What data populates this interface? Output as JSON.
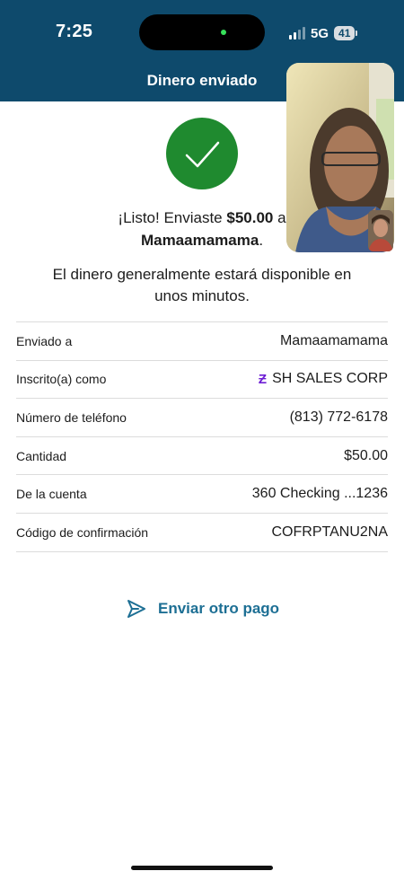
{
  "status_bar": {
    "time": "7:25",
    "network": "5G",
    "battery": "41"
  },
  "header": {
    "title": "Dinero enviado"
  },
  "confirmation": {
    "line1_prefix": "¡Listo! Enviaste ",
    "amount": "$50.00",
    "line1_suffix": " a",
    "recipient": "Mamaamamama",
    "recipient_suffix": ".",
    "availability": "El dinero generalmente estará disponible en unos minutos."
  },
  "details": [
    {
      "label": "Enviado a",
      "value": "Mamaamamama"
    },
    {
      "label": "Inscrito(a) como",
      "value": "SH SALES CORP",
      "icon": "zelle-icon"
    },
    {
      "label": "Número de teléfono",
      "value": "(813) 772-6178"
    },
    {
      "label": "Cantidad",
      "value": "$50.00"
    },
    {
      "label": "De la cuenta",
      "value": "360 Checking ...1236"
    },
    {
      "label": "Código de confirmación",
      "value": "COFRPTANU2NA"
    }
  ],
  "actions": {
    "send_another": "Enviar otro pago"
  },
  "colors": {
    "header_bg": "#0e4a6c",
    "success": "#1f8a2f",
    "link": "#1d6f94",
    "zelle": "#6d1ed4"
  }
}
